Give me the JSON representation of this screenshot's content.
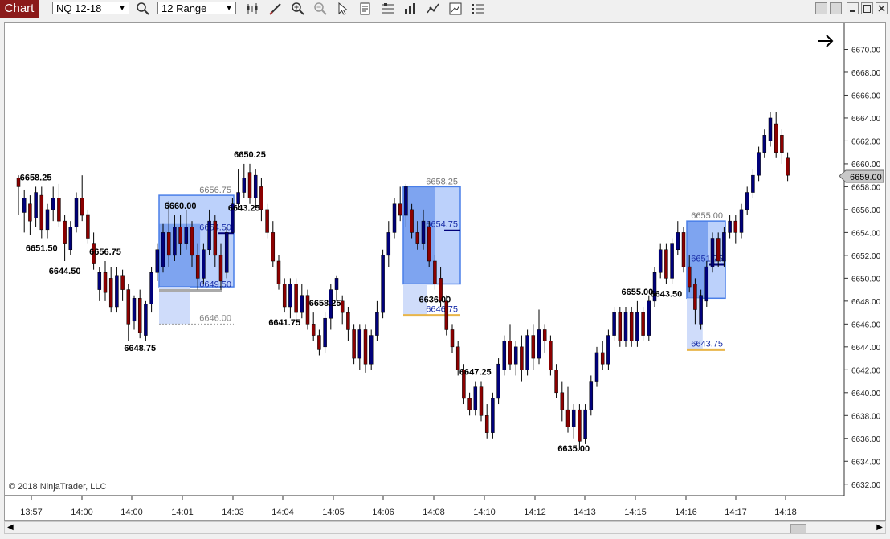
{
  "toolbar": {
    "chart_tab": "Chart",
    "instrument": "NQ 12-18",
    "bar_type": "12 Range",
    "icons": [
      "search-icon",
      "bar-style-icon",
      "drawing-tool-icon",
      "zoom-in-icon",
      "zoom-out-icon",
      "pointer-icon",
      "data-box-icon",
      "template-icon",
      "strategies-icon",
      "indicators-icon",
      "properties-icon",
      "list-icon"
    ]
  },
  "copyright": "© 2018 NinjaTrader, LLC",
  "colors": {
    "up": "#00007a",
    "down": "#8b0000",
    "zone": "#4a7fe8",
    "gold": "#e8b54a",
    "price_marker": "#c8c8c8"
  },
  "current_price": "6659.00",
  "chart_data": {
    "type": "candlestick",
    "ylim": [
      6631,
      6672
    ],
    "y_ticks": [
      "6632.00",
      "6634.00",
      "6636.00",
      "6638.00",
      "6640.00",
      "6642.00",
      "6644.00",
      "6646.00",
      "6648.00",
      "6650.00",
      "6652.00",
      "6654.00",
      "6656.00",
      "6658.00",
      "6660.00",
      "6662.00",
      "6664.00",
      "6666.00",
      "6668.00",
      "6670.00"
    ],
    "x_ticks": [
      "13:57",
      "14:00",
      "14:00",
      "14:01",
      "14:03",
      "14:04",
      "14:05",
      "14:06",
      "14:08",
      "14:10",
      "14:12",
      "14:13",
      "14:15",
      "14:16",
      "14:17",
      "14:18"
    ],
    "candles": [
      [
        6658.75,
        6658.0,
        6659.0,
        6655.5
      ],
      [
        6655.75,
        6657.0,
        6657.75,
        6654.0
      ],
      [
        6656.5,
        6655.0,
        6657.25,
        6653.75
      ],
      [
        6655.25,
        6657.5,
        6658.0,
        6654.5
      ],
      [
        6657.25,
        6654.25,
        6658.0,
        6653.5
      ],
      [
        6654.25,
        6656.0,
        6656.5,
        6653.5
      ],
      [
        6656.0,
        6657.0,
        6658.0,
        6655.0
      ],
      [
        6657.0,
        6655.0,
        6658.25,
        6654.5
      ],
      [
        6655.0,
        6653.0,
        6655.5,
        6651.5
      ],
      [
        6652.5,
        6654.5,
        6655.0,
        6652.0
      ],
      [
        6654.5,
        6657.0,
        6657.5,
        6654.0
      ],
      [
        6657.0,
        6655.5,
        6659.0,
        6655.0
      ],
      [
        6655.5,
        6653.5,
        6656.0,
        6653.0
      ],
      [
        6653.0,
        6651.25,
        6654.0,
        6650.75
      ],
      [
        6649.0,
        6650.5,
        6651.0,
        6648.0
      ],
      [
        6650.5,
        6648.75,
        6651.5,
        6648.0
      ],
      [
        6650.0,
        6647.5,
        6651.0,
        6647.0
      ],
      [
        6647.5,
        6650.25,
        6651.0,
        6647.0
      ],
      [
        6650.25,
        6649.0,
        6650.75,
        6648.0
      ],
      [
        6649.0,
        6646.0,
        6649.5,
        6644.5
      ],
      [
        6646.25,
        6648.25,
        6648.5,
        6645.5
      ],
      [
        6648.25,
        6645.25,
        6649.0,
        6644.75
      ],
      [
        6645.0,
        6647.75,
        6648.0,
        6644.5
      ],
      [
        6647.75,
        6650.5,
        6651.0,
        6647.0
      ],
      [
        6650.5,
        6652.5,
        6653.0,
        6649.75
      ],
      [
        6651.0,
        6654.0,
        6654.75,
        6650.5
      ],
      [
        6654.0,
        6652.0,
        6656.75,
        6651.0
      ],
      [
        6652.0,
        6654.5,
        6655.5,
        6651.5
      ],
      [
        6654.5,
        6653.0,
        6655.5,
        6652.0
      ],
      [
        6653.0,
        6654.5,
        6656.0,
        6652.5
      ],
      [
        6654.5,
        6652.0,
        6655.0,
        6651.0
      ],
      [
        6652.0,
        6650.0,
        6653.0,
        6649.0
      ],
      [
        6650.0,
        6652.5,
        6653.0,
        6649.5
      ],
      [
        6652.5,
        6655.0,
        6656.0,
        6652.0
      ],
      [
        6655.0,
        6652.0,
        6655.5,
        6651.0
      ],
      [
        6652.0,
        6649.75,
        6653.0,
        6649.0
      ],
      [
        6650.5,
        6654.0,
        6654.5,
        6650.0
      ],
      [
        6654.0,
        6656.5,
        6657.0,
        6654.0
      ],
      [
        6656.5,
        6657.5,
        6659.5,
        6656.0
      ],
      [
        6657.5,
        6658.75,
        6660.0,
        6657.0
      ],
      [
        6659.25,
        6657.0,
        6660.0,
        6656.5
      ],
      [
        6657.0,
        6659.0,
        6659.5,
        6656.0
      ],
      [
        6658.0,
        6656.0,
        6658.75,
        6655.0
      ],
      [
        6656.0,
        6654.0,
        6656.5,
        6653.5
      ],
      [
        6654.0,
        6651.5,
        6655.0,
        6651.0
      ],
      [
        6651.5,
        6649.5,
        6652.0,
        6649.0
      ],
      [
        6649.5,
        6647.5,
        6650.0,
        6647.0
      ],
      [
        6647.5,
        6649.5,
        6650.0,
        6646.5
      ],
      [
        6649.5,
        6647.0,
        6650.0,
        6646.0
      ],
      [
        6647.0,
        6648.5,
        6649.5,
        6646.5
      ],
      [
        6648.5,
        6646.0,
        6649.0,
        6645.5
      ],
      [
        6646.0,
        6645.0,
        6647.0,
        6644.5
      ],
      [
        6645.0,
        6643.75,
        6645.5,
        6643.25
      ],
      [
        6644.0,
        6646.5,
        6647.0,
        6643.5
      ],
      [
        6646.5,
        6649.0,
        6649.5,
        6645.5
      ],
      [
        6649.0,
        6650.0,
        6650.25,
        6648.0
      ],
      [
        6648.0,
        6647.0,
        6648.5,
        6646.0
      ],
      [
        6647.0,
        6645.5,
        6647.5,
        6644.5
      ],
      [
        6645.5,
        6643.0,
        6646.0,
        6642.5
      ],
      [
        6643.0,
        6645.5,
        6646.0,
        6642.0
      ],
      [
        6645.5,
        6642.5,
        6646.0,
        6641.75
      ],
      [
        6642.5,
        6645.0,
        6645.5,
        6642.0
      ],
      [
        6645.0,
        6647.0,
        6648.0,
        6644.5
      ],
      [
        6647.0,
        6652.0,
        6652.5,
        6646.5
      ],
      [
        6652.0,
        6654.0,
        6655.0,
        6651.0
      ],
      [
        6654.0,
        6656.5,
        6657.0,
        6653.5
      ],
      [
        6656.5,
        6655.5,
        6658.0,
        6655.0
      ],
      [
        6655.5,
        6658.0,
        6658.25,
        6654.5
      ],
      [
        6656.0,
        6654.0,
        6656.5,
        6653.5
      ],
      [
        6654.0,
        6653.0,
        6655.0,
        6652.5
      ],
      [
        6653.0,
        6655.0,
        6656.0,
        6652.5
      ],
      [
        6654.5,
        6651.5,
        6655.0,
        6651.0
      ],
      [
        6651.5,
        6649.5,
        6652.0,
        6649.0
      ],
      [
        6650.0,
        6648.0,
        6651.0,
        6647.5
      ],
      [
        6648.0,
        6645.5,
        6648.5,
        6645.0
      ],
      [
        6645.5,
        6644.0,
        6646.0,
        6643.5
      ],
      [
        6644.0,
        6642.0,
        6644.5,
        6641.5
      ],
      [
        6642.0,
        6639.5,
        6642.5,
        6639.0
      ],
      [
        6639.5,
        6638.5,
        6640.0,
        6638.0
      ],
      [
        6638.5,
        6640.5,
        6641.0,
        6638.0
      ],
      [
        6640.5,
        6638.0,
        6641.0,
        6637.5
      ],
      [
        6638.0,
        6636.5,
        6639.0,
        6636.0
      ],
      [
        6636.5,
        6639.5,
        6640.0,
        6636.0
      ],
      [
        6639.5,
        6642.5,
        6643.0,
        6639.0
      ],
      [
        6642.0,
        6644.5,
        6645.0,
        6641.5
      ],
      [
        6644.5,
        6642.5,
        6646.0,
        6642.0
      ],
      [
        6642.5,
        6644.0,
        6644.5,
        6641.5
      ],
      [
        6644.0,
        6642.0,
        6645.0,
        6641.0
      ],
      [
        6642.0,
        6645.0,
        6645.5,
        6641.5
      ],
      [
        6645.0,
        6643.0,
        6646.0,
        6642.0
      ],
      [
        6643.0,
        6645.5,
        6647.25,
        6642.5
      ],
      [
        6645.5,
        6644.5,
        6646.0,
        6643.5
      ],
      [
        6644.5,
        6642.0,
        6645.0,
        6641.5
      ],
      [
        6642.0,
        6640.0,
        6642.5,
        6639.5
      ],
      [
        6640.0,
        6638.5,
        6641.0,
        6637.5
      ],
      [
        6638.5,
        6637.0,
        6640.5,
        6636.5
      ],
      [
        6637.0,
        6638.5,
        6639.0,
        6636.0
      ],
      [
        6638.5,
        6635.75,
        6639.0,
        6635.0
      ],
      [
        6636.0,
        6638.5,
        6639.0,
        6635.5
      ],
      [
        6638.5,
        6641.0,
        6641.5,
        6638.0
      ],
      [
        6641.0,
        6643.5,
        6644.0,
        6640.5
      ],
      [
        6643.5,
        6642.5,
        6644.5,
        6642.0
      ],
      [
        6642.5,
        6645.0,
        6645.5,
        6642.0
      ],
      [
        6645.0,
        6647.0,
        6647.5,
        6644.5
      ],
      [
        6647.0,
        6644.5,
        6647.5,
        6644.0
      ],
      [
        6644.5,
        6647.0,
        6647.5,
        6644.0
      ],
      [
        6647.0,
        6644.5,
        6647.5,
        6644.0
      ],
      [
        6644.5,
        6647.0,
        6648.0,
        6644.0
      ],
      [
        6647.0,
        6645.0,
        6647.5,
        6644.5
      ],
      [
        6645.0,
        6648.0,
        6648.5,
        6644.5
      ],
      [
        6648.0,
        6650.5,
        6651.0,
        6647.5
      ],
      [
        6650.5,
        6652.5,
        6653.0,
        6650.0
      ],
      [
        6652.5,
        6650.0,
        6653.0,
        6649.5
      ],
      [
        6650.0,
        6653.0,
        6653.5,
        6649.5
      ],
      [
        6652.5,
        6654.0,
        6655.0,
        6652.0
      ],
      [
        6654.0,
        6651.0,
        6654.5,
        6650.5
      ],
      [
        6651.0,
        6649.25,
        6652.0,
        6648.75
      ],
      [
        6649.5,
        6647.25,
        6650.0,
        6646.0
      ],
      [
        6646.0,
        6648.5,
        6649.0,
        6645.5
      ],
      [
        6648.0,
        6651.0,
        6651.5,
        6647.5
      ],
      [
        6651.0,
        6653.5,
        6654.0,
        6650.5
      ],
      [
        6653.5,
        6651.5,
        6654.0,
        6651.0
      ],
      [
        6651.5,
        6654.0,
        6654.5,
        6651.0
      ],
      [
        6654.0,
        6655.0,
        6655.5,
        6653.5
      ],
      [
        6655.0,
        6654.0,
        6655.5,
        6653.0
      ],
      [
        6654.0,
        6656.0,
        6656.5,
        6653.5
      ],
      [
        6656.0,
        6657.5,
        6658.0,
        6655.5
      ],
      [
        6657.5,
        6659.0,
        6659.5,
        6657.0
      ],
      [
        6659.0,
        6661.0,
        6661.5,
        6658.5
      ],
      [
        6661.0,
        6662.5,
        6663.0,
        6660.5
      ],
      [
        6662.0,
        6664.0,
        6664.5,
        6661.5
      ],
      [
        6663.5,
        6661.0,
        6664.5,
        6660.5
      ],
      [
        6662.5,
        6661.0,
        6663.0,
        6660.0
      ],
      [
        6660.5,
        6659.0,
        6661.0,
        6658.5
      ]
    ],
    "labels": [
      {
        "bar": 3,
        "text": "6658.25",
        "pos": "above"
      },
      {
        "bar": 4,
        "text": "6651.50",
        "pos": "below"
      },
      {
        "bar": 8,
        "text": "6644.50",
        "pos": "below"
      },
      {
        "bar": 15,
        "text": "6656.75",
        "pos": "above"
      },
      {
        "bar": 21,
        "text": "6648.75",
        "pos": "below"
      },
      {
        "bar": 28,
        "text": "6660.00",
        "pos": "above"
      },
      {
        "bar": 39,
        "text": "6643.25",
        "pos": "below"
      },
      {
        "bar": 40,
        "text": "6650.25",
        "pos": "above"
      },
      {
        "bar": 46,
        "text": "6641.75",
        "pos": "below"
      },
      {
        "bar": 53,
        "text": "6658.25",
        "pos": "above"
      },
      {
        "bar": 72,
        "text": "6636.00",
        "pos": "below"
      },
      {
        "bar": 79,
        "text": "6647.25",
        "pos": "above"
      },
      {
        "bar": 96,
        "text": "6635.00",
        "pos": "below"
      },
      {
        "bar": 107,
        "text": "6655.00",
        "pos": "above"
      },
      {
        "bar": 112,
        "text": "6643.50",
        "pos": "below"
      }
    ],
    "zones": [
      {
        "x1": 197,
        "x2": 290,
        "top": 6657.25,
        "bottom": 6649.25,
        "inner_top": 6654.75,
        "line1": "6656.75",
        "line2": "6654.50",
        "line3": "6649.50",
        "tail_top": 6649.25,
        "tail_bottom": 6646.0,
        "tail_label": "6646.00"
      },
      {
        "x1": 501,
        "x2": 572,
        "top": 6658.0,
        "bottom": 6649.5,
        "inner_top": 6658.0,
        "line1": "6658.25",
        "line2": "6654.75",
        "line3": "",
        "tail_top": 6649.5,
        "tail_bottom": 6646.75,
        "tail_label": "6646.75"
      },
      {
        "x1": 854,
        "x2": 902,
        "top": 6655.0,
        "bottom": 6648.25,
        "inner_top": 6655.0,
        "line1": "6655.00",
        "line2": "6651.75",
        "line3": "",
        "tail_top": 6648.25,
        "tail_bottom": 6643.75,
        "tail_label": "6643.75"
      }
    ]
  }
}
